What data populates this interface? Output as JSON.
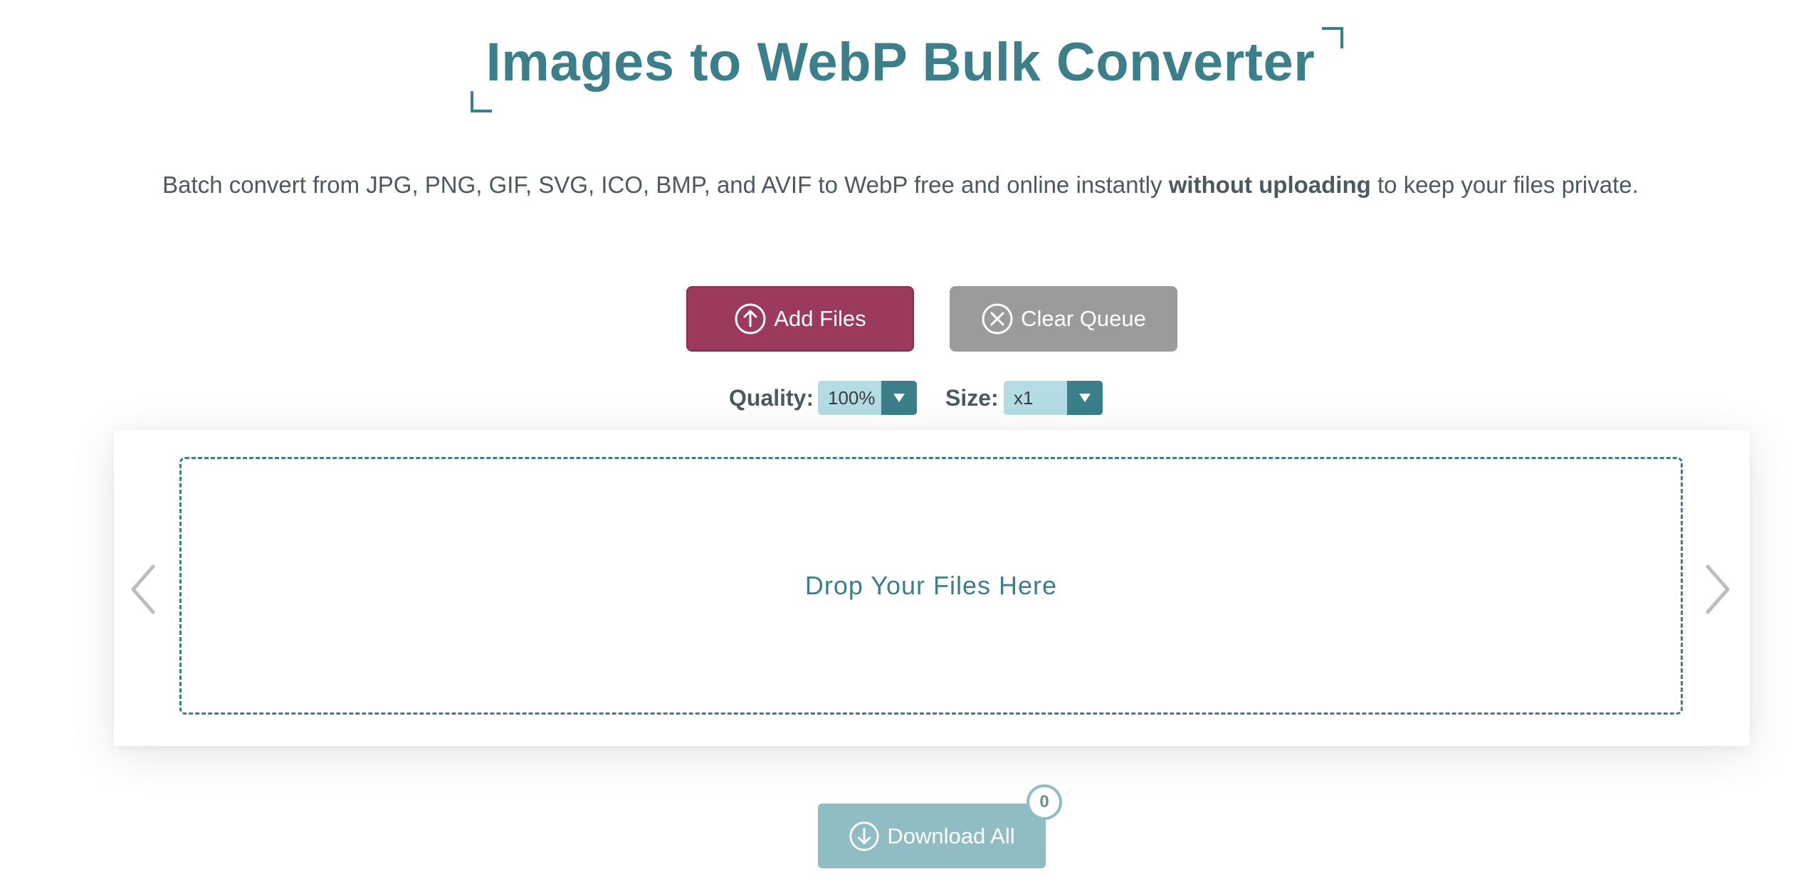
{
  "header": {
    "title": "Images to WebP Bulk Converter",
    "subtitle_before": "Batch convert from JPG, PNG, GIF, SVG, ICO, BMP, and AVIF to WebP free and online instantly ",
    "subtitle_bold": "without uploading",
    "subtitle_after": " to keep your files private."
  },
  "actions": {
    "add_label": "Add Files",
    "clear_label": "Clear Queue",
    "add_icon": "upload-circle-icon",
    "clear_icon": "close-circle-icon"
  },
  "options": {
    "quality_label": "Quality:",
    "quality_value": "100%",
    "size_label": "Size:",
    "size_value": "x1"
  },
  "dropzone": {
    "text": "Drop Your Files Here",
    "prev_icon": "chevron-left-icon",
    "next_icon": "chevron-right-icon"
  },
  "download": {
    "label": "Download All",
    "icon": "download-circle-icon",
    "count": "0"
  },
  "colors": {
    "accent": "#3a7f89",
    "add_button": "#9c3a5e",
    "clear_button": "#9b9b9b",
    "download_button": "#8fbdc3",
    "select_bg": "#b3dde3"
  }
}
